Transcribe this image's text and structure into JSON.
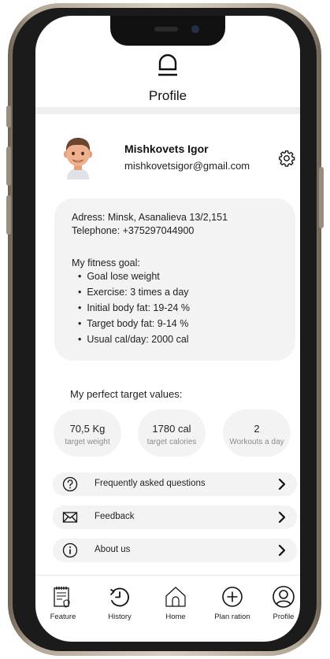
{
  "header": {
    "title": "Profile",
    "icon": "profile-header-icon"
  },
  "user": {
    "name": "Mishkovets Igor",
    "email": "mishkovetsigor@gmail.com"
  },
  "info": {
    "address": "Adress: Minsk, Asanalieva 13/2,151",
    "telephone": "Telephone: +375297044900",
    "goal_title": "My fitness goal:",
    "goals": [
      "Goal lose weight",
      "Exercise: 3 times a day",
      "Initial body fat: 19-24 %",
      "Target body fat: 9-14 %",
      "Usual cal/day: 2000 cal"
    ]
  },
  "targets": {
    "label": "My perfect target values:",
    "items": [
      {
        "value": "70,5 Kg",
        "label": "target weight"
      },
      {
        "value": "1780 cal",
        "label": "target calories"
      },
      {
        "value": "2",
        "label": "Workouts a day"
      }
    ]
  },
  "menu": [
    {
      "label": "Frequently asked questions",
      "icon": "question-icon"
    },
    {
      "label": "Feedback",
      "icon": "envelope-icon"
    },
    {
      "label": "About us",
      "icon": "info-icon"
    }
  ],
  "tabs": [
    {
      "label": "Feature",
      "icon": "notepad-icon"
    },
    {
      "label": "History",
      "icon": "history-clock-icon"
    },
    {
      "label": "Home",
      "icon": "home-icon"
    },
    {
      "label": "Plan ration",
      "icon": "plus-circle-icon"
    },
    {
      "label": "Profile",
      "icon": "user-circle-icon"
    }
  ],
  "colors": {
    "card_bg": "#f3f3f3",
    "text": "#222222",
    "muted": "#8b8b8b",
    "frame": "#1b1b1b"
  }
}
